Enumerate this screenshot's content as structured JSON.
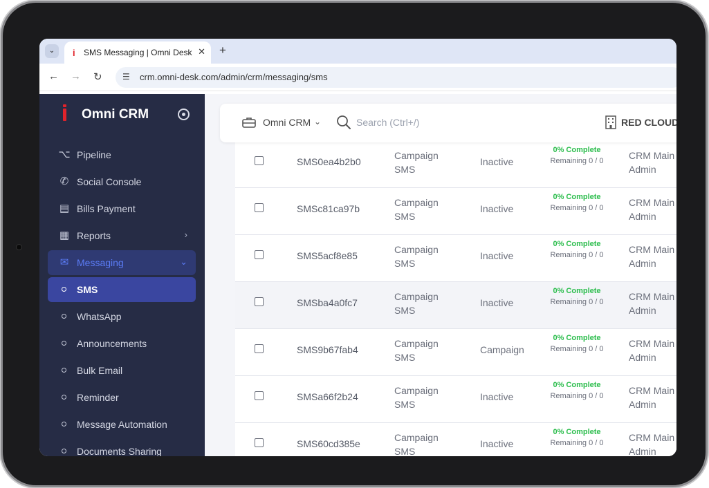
{
  "browser": {
    "tab_title": "SMS Messaging | Omni Desk",
    "tab_favicon": "i",
    "url": "crm.omni-desk.com/admin/crm/messaging/sms"
  },
  "sidebar": {
    "brand": "Omni CRM",
    "items": [
      {
        "label": "Pipeline",
        "icon": "pipeline-icon"
      },
      {
        "label": "Social Console",
        "icon": "whatsapp-icon"
      },
      {
        "label": "Bills Payment",
        "icon": "card-icon"
      },
      {
        "label": "Reports",
        "icon": "chart-icon"
      },
      {
        "label": "Messaging",
        "icon": "message-icon"
      }
    ],
    "subitems": [
      "SMS",
      "WhatsApp",
      "Announcements",
      "Bulk Email",
      "Reminder",
      "Message Automation",
      "Documents Sharing"
    ]
  },
  "topbar": {
    "workspace": "Omni CRM",
    "search_placeholder": "Search (Ctrl+/)",
    "company": "RED CLOUD"
  },
  "rows": [
    {
      "id": "SMS0ea4b2b0",
      "type": "Campaign SMS",
      "status": "Inactive",
      "progress": "0% Complete",
      "remaining": "Remaining 0 / 0",
      "owner": "CRM Main Admin"
    },
    {
      "id": "SMSc81ca97b",
      "type": "Campaign SMS",
      "status": "Inactive",
      "progress": "0% Complete",
      "remaining": "Remaining 0 / 0",
      "owner": "CRM Main Admin"
    },
    {
      "id": "SMS5acf8e85",
      "type": "Campaign SMS",
      "status": "Inactive",
      "progress": "0% Complete",
      "remaining": "Remaining 0 / 0",
      "owner": "CRM Main Admin"
    },
    {
      "id": "SMSba4a0fc7",
      "type": "Campaign SMS",
      "status": "Inactive",
      "progress": "0% Complete",
      "remaining": "Remaining 0 / 0",
      "owner": "CRM Main Admin"
    },
    {
      "id": "SMS9b67fab4",
      "type": "Campaign SMS",
      "status": "Campaign",
      "progress": "0% Complete",
      "remaining": "Remaining 0 / 0",
      "owner": "CRM Main Admin"
    },
    {
      "id": "SMSa66f2b24",
      "type": "Campaign SMS",
      "status": "Inactive",
      "progress": "0% Complete",
      "remaining": "Remaining 0 / 0",
      "owner": "CRM Main Admin"
    },
    {
      "id": "SMS60cd385e",
      "type": "Campaign SMS",
      "status": "Inactive",
      "progress": "0% Complete",
      "remaining": "Remaining 0 / 0",
      "owner": "CRM Main Admin"
    }
  ]
}
